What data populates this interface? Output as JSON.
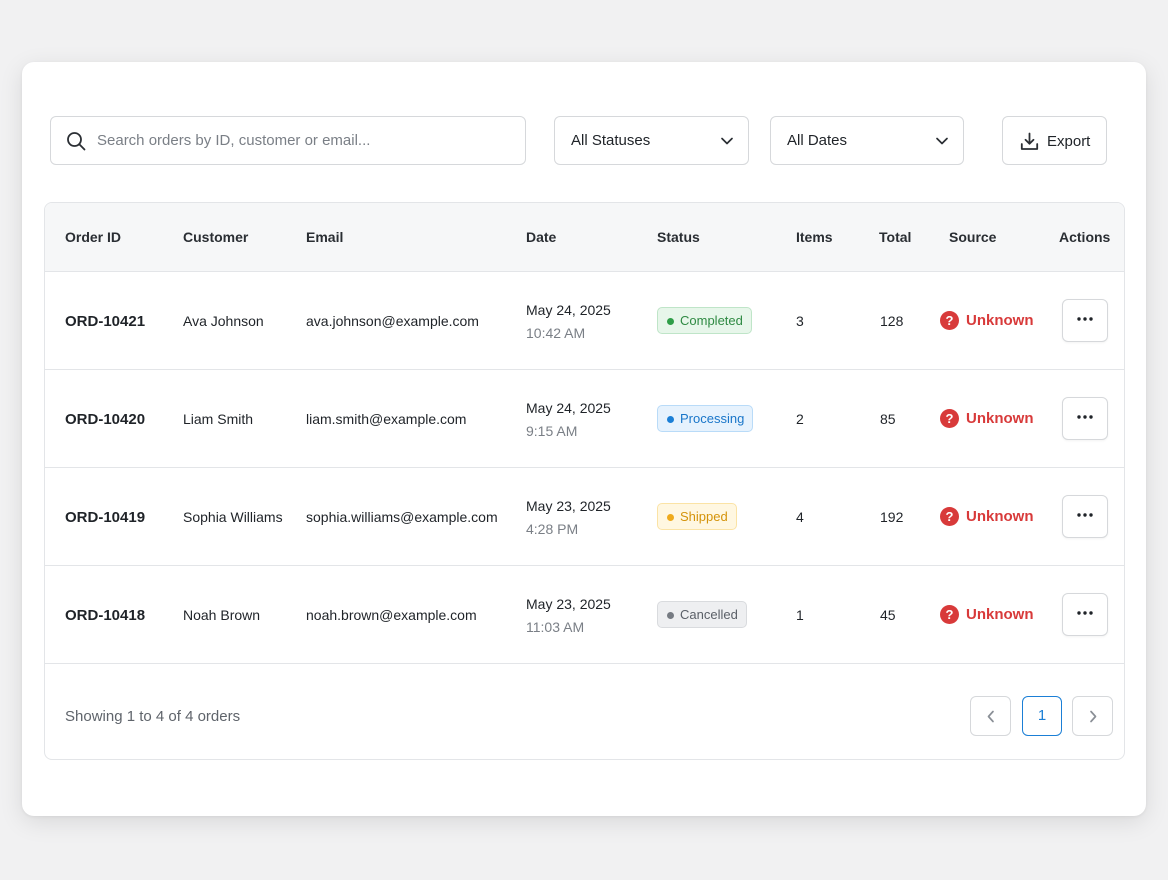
{
  "toolbar": {
    "search_placeholder": "Search orders by ID, customer or email...",
    "search_value": "",
    "status_filter": "All Statuses",
    "date_filter": "All Dates",
    "export_label": "Export"
  },
  "table": {
    "columns": [
      "Order ID",
      "Customer",
      "Email",
      "Date",
      "Status",
      "Items",
      "Total",
      "Source",
      "Actions"
    ],
    "rows": [
      {
        "id": "ORD-10421",
        "customer": "Ava Johnson",
        "email": "ava.johnson@example.com",
        "date": "May 24, 2025",
        "time": "10:42 AM",
        "status": "Completed",
        "items": "3",
        "total": "128",
        "source": "Unknown"
      },
      {
        "id": "ORD-10420",
        "customer": "Liam Smith",
        "email": "liam.smith@example.com",
        "date": "May 24, 2025",
        "time": "9:15 AM",
        "status": "Processing",
        "items": "2",
        "total": "85",
        "source": "Unknown"
      },
      {
        "id": "ORD-10419",
        "customer": "Sophia Williams",
        "email": "sophia.williams@example.com",
        "date": "May 23, 2025",
        "time": "4:28 PM",
        "status": "Shipped",
        "items": "4",
        "total": "192",
        "source": "Unknown"
      },
      {
        "id": "ORD-10418",
        "customer": "Noah Brown",
        "email": "noah.brown@example.com",
        "date": "May 23, 2025",
        "time": "11:03 AM",
        "status": "Cancelled",
        "items": "1",
        "total": "45",
        "source": "Unknown"
      }
    ]
  },
  "footer": {
    "summary": "Showing 1 to 4 of 4 orders",
    "current_page": "1"
  },
  "colors": {
    "accent": "#1b7fd6",
    "completed": "#2f9e48",
    "processing": "#1b7fd6",
    "shipped": "#efaa1b",
    "cancelled": "#767b82",
    "unknown_source": "#d83a3a"
  },
  "icons": {
    "search": "search-icon",
    "dropdown": "chevron-down-icon",
    "export": "download-icon",
    "source_unknown": "question-circle-icon",
    "row_actions": "more-horizontal-icon",
    "prev": "chevron-left-icon",
    "next": "chevron-right-icon"
  }
}
